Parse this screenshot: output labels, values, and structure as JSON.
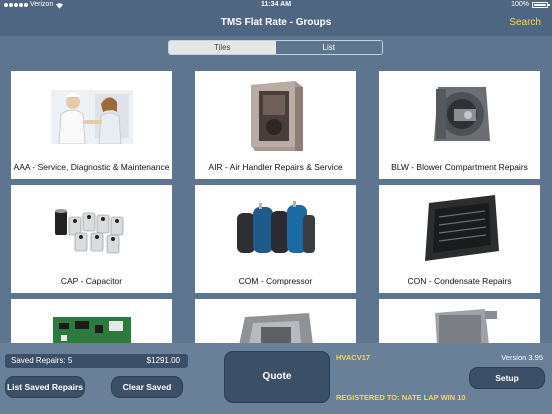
{
  "status": {
    "carrier": "Verizon",
    "time": "11:34 AM",
    "battery": "100%"
  },
  "nav": {
    "title": "TMS Flat Rate  -  Groups",
    "search": "Search"
  },
  "segment": {
    "tiles": "Tiles",
    "list": "List"
  },
  "tiles": [
    {
      "label": "AAA - Service, Diagnostic & Maintenance",
      "icon": "handshake-photo"
    },
    {
      "label": "AIR - Air Handler Repairs & Service",
      "icon": "air-handler-photo"
    },
    {
      "label": "BLW - Blower Compartment Repairs",
      "icon": "blower-photo"
    },
    {
      "label": "CAP - Capacitor",
      "icon": "capacitors-photo"
    },
    {
      "label": "COM - Compressor",
      "icon": "compressors-photo"
    },
    {
      "label": "CON - Condensate Repairs",
      "icon": "drain-pan-photo"
    },
    {
      "label": "",
      "icon": "circuit-board-photo"
    },
    {
      "label": "",
      "icon": "duct-photo"
    },
    {
      "label": "",
      "icon": "electrical-box-photo"
    }
  ],
  "footer": {
    "saved_label": "Saved Repairs:  5",
    "saved_total": "$1291.00",
    "list_saved": "List Saved Repairs",
    "clear_saved": "Clear Saved",
    "quote": "Quote",
    "code": "HVACV17",
    "version": "Version 3.95",
    "setup": "Setup",
    "registered": "REGISTERED TO:  NATE LAP WIN 10"
  },
  "colors": {
    "accent": "#f5d84a",
    "bar": "#4f6683",
    "button": "#3b4f66"
  }
}
